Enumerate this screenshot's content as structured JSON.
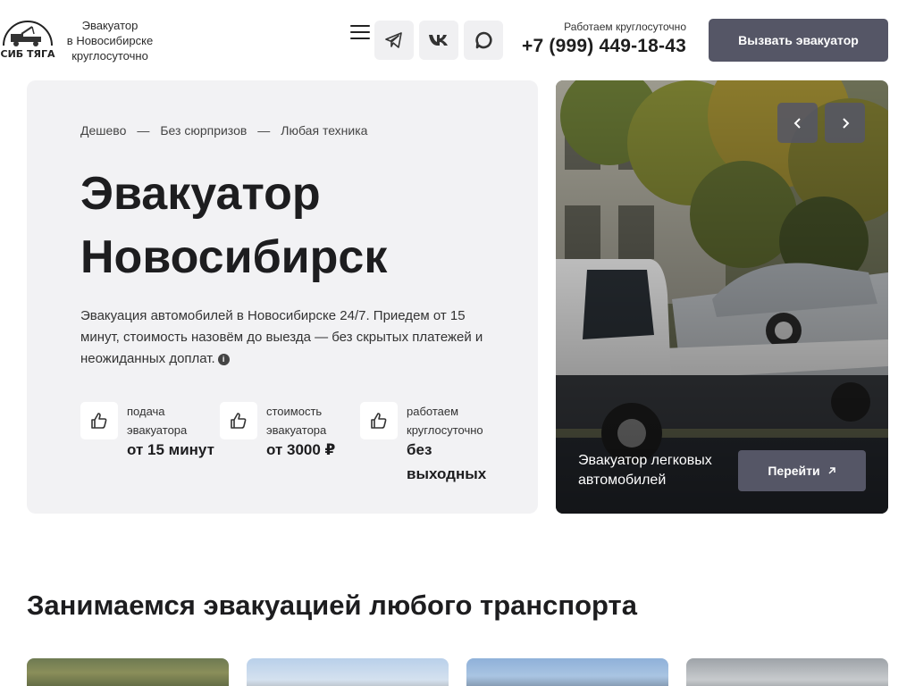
{
  "header": {
    "logo_text": "СИБ ТЯГА",
    "tagline": [
      "Эвакуатор",
      "в Новосибирске",
      "круглосуточно"
    ],
    "work_hours": "Работаем круглосуточно",
    "phone": "+7 (999) 449-18-43",
    "call_button": "Вызвать эвакуатор",
    "social_icons": [
      "telegram-icon",
      "vk-icon",
      "max-messenger-icon"
    ]
  },
  "hero": {
    "breadcrumbs": [
      "Дешево",
      "Без сюрпризов",
      "Любая техника"
    ],
    "separator": "—",
    "title_lines": [
      "Эвакуатор",
      "Новосибирск"
    ],
    "lead": "Эвакуация автомобилей в Новосибирске 24/7. Приедем от 15 минут, стоимость назовём до выезда — без скрытых платежей и неожиданных доплат.",
    "info_glyph": "i",
    "features": [
      {
        "label": "подача эвакуатора",
        "value": "от 15 минут",
        "icon": "thumbs-up-icon"
      },
      {
        "label": "стоимость эвакуатора",
        "value": "от 3000 ₽",
        "icon": "thumbs-up-icon"
      },
      {
        "label": "работаем круглосуточно",
        "value": "без выходных",
        "icon": "thumbs-up-icon"
      }
    ]
  },
  "slider": {
    "caption": "Эвакуатор легковых автомобилей",
    "button": "Перейти"
  },
  "section": {
    "title": "Занимаемся эвакуацией любого транспорта"
  },
  "colors": {
    "accent": "#555666",
    "hero_bg": "#f2f2f4",
    "text_dark": "#1d1d1f"
  }
}
